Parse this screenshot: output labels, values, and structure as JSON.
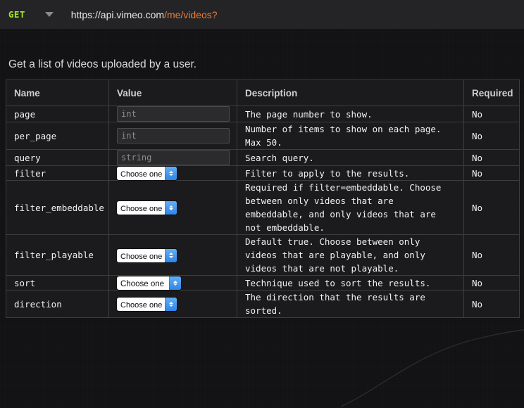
{
  "urlbar": {
    "method": "GET",
    "method_caret_icon": "triangle-down-icon",
    "url_host": "https://api.vimeo.com",
    "url_path": "/me/videos?"
  },
  "page": {
    "title": "Get a list of videos uploaded by a user."
  },
  "table": {
    "headers": [
      "Name",
      "Value",
      "Description",
      "Required"
    ],
    "rows": [
      {
        "name": "page",
        "control": "input",
        "placeholder": "int",
        "value": "",
        "description": "The page number to show.",
        "required": "No"
      },
      {
        "name": "per_page",
        "control": "input",
        "placeholder": "int",
        "value": "",
        "description": "Number of items to show on each page. Max 50.",
        "required": "No"
      },
      {
        "name": "query",
        "control": "input",
        "placeholder": "string",
        "value": "",
        "description": "Search query.",
        "required": "No"
      },
      {
        "name": "filter",
        "control": "select",
        "selected": "Choose one",
        "description": "Filter to apply to the results.",
        "required": "No"
      },
      {
        "name": "filter_embeddable",
        "control": "select",
        "selected": "Choose one",
        "description": "Required if filter=embeddable. Choose between only videos that are embeddable, and only videos that are not embeddable.",
        "required": "No"
      },
      {
        "name": "filter_playable",
        "control": "select",
        "selected": "Choose one",
        "description": "Default true. Choose between only videos that are playable, and only videos that are not playable.",
        "required": "No"
      },
      {
        "name": "sort",
        "control": "select",
        "selected": "Choose one",
        "description": "Technique used to sort the results.",
        "required": "No"
      },
      {
        "name": "direction",
        "control": "select",
        "selected": "Choose one",
        "description": "The direction that the results are sorted.",
        "required": "No"
      }
    ]
  },
  "colors": {
    "method_green": "#a6e22e",
    "url_path_orange": "#f07b2b",
    "select_blue": "#2e87e8",
    "page_background": "#121214",
    "urlbar_background": "#242427"
  }
}
